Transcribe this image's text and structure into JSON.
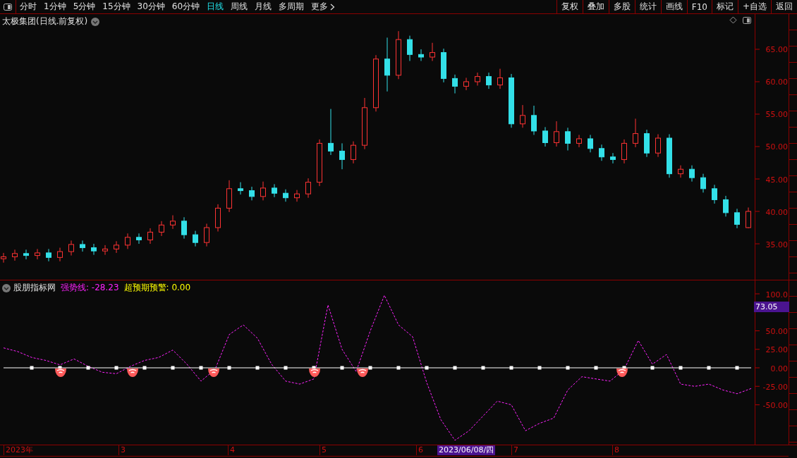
{
  "toolbar": {
    "tabs": [
      {
        "label": "分时",
        "selected": false
      },
      {
        "label": "1分钟",
        "selected": false
      },
      {
        "label": "5分钟",
        "selected": false
      },
      {
        "label": "15分钟",
        "selected": false
      },
      {
        "label": "30分钟",
        "selected": false
      },
      {
        "label": "60分钟",
        "selected": false
      },
      {
        "label": "日线",
        "selected": true
      },
      {
        "label": "周线",
        "selected": false
      },
      {
        "label": "月线",
        "selected": false
      },
      {
        "label": "多周期",
        "selected": false
      },
      {
        "label": "更多",
        "selected": false,
        "kind": "menu"
      }
    ],
    "buttons": [
      "复权",
      "叠加",
      "多股",
      "统计",
      "画线",
      "F10",
      "标记",
      "+自选",
      "返回"
    ]
  },
  "price_panel": {
    "title": "太极集团(日线.前复权)",
    "chart_data": {
      "type": "candlestick",
      "ylim": [
        29.46,
        70.43
      ],
      "yticks": [
        {
          "value": 65,
          "label": "65.00"
        },
        {
          "value": 60,
          "label": "60.00"
        },
        {
          "value": 55,
          "label": "55.00"
        },
        {
          "value": 50,
          "label": "50.00"
        },
        {
          "value": 45,
          "label": "45.00"
        },
        {
          "value": 40,
          "label": "40.00"
        },
        {
          "value": 35,
          "label": "35.00"
        }
      ],
      "ohlc": [
        [
          32.7,
          33.6,
          32.1,
          33.0
        ],
        [
          33.0,
          34.1,
          32.4,
          33.5
        ],
        [
          33.5,
          34.1,
          32.6,
          33.2
        ],
        [
          33.2,
          34.2,
          32.6,
          33.6
        ],
        [
          33.6,
          34.2,
          32.3,
          32.9
        ],
        [
          32.9,
          34.4,
          32.3,
          33.8
        ],
        [
          33.8,
          35.5,
          33.2,
          34.9
        ],
        [
          34.9,
          35.5,
          33.8,
          34.4
        ],
        [
          34.4,
          35.0,
          33.3,
          33.9
        ],
        [
          33.9,
          34.8,
          33.3,
          34.2
        ],
        [
          34.2,
          35.4,
          33.6,
          34.8
        ],
        [
          34.8,
          36.6,
          34.2,
          36.0
        ],
        [
          36.0,
          36.6,
          35.0,
          35.6
        ],
        [
          35.6,
          37.4,
          35.0,
          36.8
        ],
        [
          36.8,
          38.5,
          36.2,
          37.9
        ],
        [
          37.9,
          39.4,
          37.3,
          38.5
        ],
        [
          38.5,
          39.1,
          35.8,
          36.4
        ],
        [
          36.4,
          37.0,
          34.6,
          35.2
        ],
        [
          35.2,
          38.1,
          34.6,
          37.5
        ],
        [
          37.5,
          41.1,
          36.9,
          40.5
        ],
        [
          40.5,
          44.8,
          39.9,
          43.5
        ],
        [
          43.5,
          44.5,
          42.6,
          43.2
        ],
        [
          43.2,
          43.8,
          41.7,
          42.3
        ],
        [
          42.3,
          44.6,
          41.7,
          43.6
        ],
        [
          43.6,
          44.2,
          42.2,
          42.8
        ],
        [
          42.8,
          43.4,
          41.5,
          42.1
        ],
        [
          42.1,
          43.3,
          41.5,
          42.7
        ],
        [
          42.7,
          45.1,
          42.1,
          44.5
        ],
        [
          44.5,
          51.1,
          43.9,
          50.5
        ],
        [
          50.5,
          55.8,
          48.7,
          49.3
        ],
        [
          49.3,
          50.5,
          46.5,
          48.0
        ],
        [
          48.0,
          50.8,
          47.4,
          50.2
        ],
        [
          50.2,
          57.5,
          49.6,
          56.0
        ],
        [
          56.0,
          64.1,
          55.4,
          63.5
        ],
        [
          63.5,
          66.8,
          58.5,
          61.0
        ],
        [
          61.0,
          67.8,
          60.4,
          66.5
        ],
        [
          66.5,
          67.1,
          63.2,
          64.2
        ],
        [
          64.2,
          65.0,
          63.2,
          63.8
        ],
        [
          63.8,
          66.0,
          63.2,
          64.5
        ],
        [
          64.5,
          65.1,
          59.9,
          60.5
        ],
        [
          60.5,
          61.1,
          58.2,
          59.3
        ],
        [
          59.3,
          60.6,
          58.7,
          60.0
        ],
        [
          60.0,
          61.4,
          59.4,
          60.8
        ],
        [
          60.8,
          61.4,
          58.9,
          59.5
        ],
        [
          59.5,
          62.0,
          58.9,
          60.6
        ],
        [
          60.6,
          61.2,
          52.9,
          53.5
        ],
        [
          53.5,
          56.4,
          52.9,
          54.8
        ],
        [
          54.8,
          56.3,
          51.8,
          52.4
        ],
        [
          52.4,
          53.0,
          50.0,
          50.6
        ],
        [
          50.6,
          53.9,
          50.0,
          52.3
        ],
        [
          52.3,
          52.9,
          49.4,
          50.5
        ],
        [
          50.5,
          51.8,
          49.9,
          51.2
        ],
        [
          51.2,
          51.8,
          49.1,
          49.7
        ],
        [
          49.7,
          50.3,
          47.8,
          48.4
        ],
        [
          48.4,
          49.0,
          47.4,
          48.0
        ],
        [
          48.0,
          51.1,
          47.4,
          50.5
        ],
        [
          50.5,
          54.3,
          49.9,
          52.0
        ],
        [
          52.0,
          52.6,
          48.4,
          49.0
        ],
        [
          49.0,
          51.9,
          48.4,
          51.3
        ],
        [
          51.3,
          51.9,
          45.2,
          45.8
        ],
        [
          45.8,
          47.1,
          45.2,
          46.5
        ],
        [
          46.5,
          47.1,
          44.6,
          45.2
        ],
        [
          45.2,
          45.8,
          42.9,
          43.5
        ],
        [
          43.5,
          44.1,
          41.2,
          41.8
        ],
        [
          41.8,
          42.4,
          39.2,
          39.8
        ],
        [
          39.8,
          40.4,
          37.4,
          38.0
        ],
        [
          37.5,
          40.6,
          37.4,
          40.0
        ]
      ]
    }
  },
  "indicator_panel": {
    "title": "股朋指标网",
    "legend": [
      {
        "label": "强势线: -28.23",
        "color": "#ff22ff"
      },
      {
        "label": "超预期预警: 0.00",
        "color": "#ffff00"
      }
    ],
    "cursor_value": "73.05",
    "chart_data": {
      "type": "line",
      "ylim": [
        -103.8,
        118.1
      ],
      "yticks": [
        {
          "value": 100,
          "label": "100.0"
        },
        {
          "value": 50,
          "label": "50.00"
        },
        {
          "value": 25,
          "label": "25.00"
        },
        {
          "value": 0,
          "label": "0.00"
        },
        {
          "value": -25,
          "label": "-25.00"
        },
        {
          "value": -50,
          "label": "-50.00"
        }
      ],
      "series": [
        {
          "color": "#ff22ff",
          "line_style": "dashed",
          "values": [
            27,
            22,
            14,
            10,
            4,
            12,
            2,
            -6,
            -8,
            2,
            10,
            14,
            24,
            5,
            -18,
            -2,
            45,
            58,
            40,
            5,
            -18,
            -22,
            -15,
            85,
            25,
            -5,
            50,
            98,
            58,
            42,
            -20,
            -70,
            -98,
            -85,
            -65,
            -45,
            -50,
            -85,
            -75,
            -68,
            -30,
            -12,
            -15,
            -18,
            -2,
            37,
            5,
            18,
            -22,
            -25,
            -22,
            -30,
            -35,
            -28
          ]
        },
        {
          "color": "#ffffff",
          "line_style": "solid",
          "values": [
            0,
            0,
            0,
            0,
            0,
            0,
            0,
            0,
            0,
            0,
            0,
            0,
            0,
            0,
            0,
            0,
            0,
            0,
            0,
            0,
            0,
            0,
            0,
            0,
            0,
            0,
            0,
            0,
            0,
            0,
            0,
            0,
            0,
            0,
            0,
            0,
            0,
            0,
            0,
            0,
            0,
            0,
            0,
            0,
            0,
            0,
            0,
            0,
            0,
            0,
            0,
            0,
            0,
            0
          ]
        }
      ]
    },
    "signal_marks": [
      {
        "kind": "warning"
      },
      {
        "kind": "warning"
      },
      {
        "kind": "warning"
      },
      {
        "kind": "warning"
      },
      {
        "kind": "warning"
      },
      {
        "kind": "warning"
      }
    ]
  },
  "time_axis": {
    "labels": [
      "2023年",
      "3",
      "4",
      "5",
      "6",
      "7",
      "8"
    ],
    "cursor_date": "2023/06/08/四"
  }
}
